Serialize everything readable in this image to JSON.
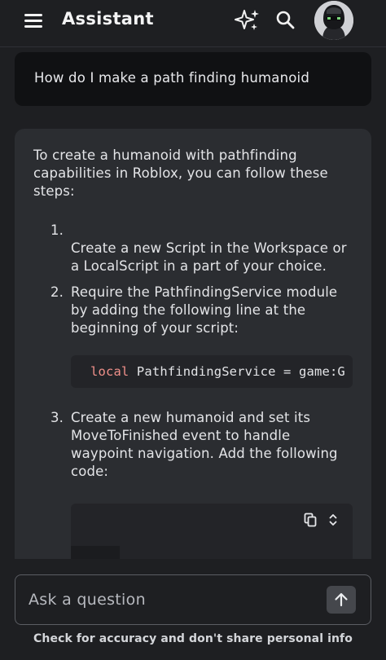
{
  "header": {
    "title": "Assistant",
    "menu_icon": "hamburger-menu-icon",
    "sparkle_icon": "sparkle-icon",
    "search_icon": "search-icon",
    "avatar_icon": "user-avatar"
  },
  "conversation": {
    "user_message": "How do I make a path finding humanoid",
    "assistant": {
      "intro": "To create a humanoid with pathfinding capabilities in Roblox, you can follow these steps:",
      "steps": [
        {
          "number": "1.",
          "text": "Create a new Script in the Workspace or a LocalScript in a part of your choice."
        },
        {
          "number": "2.",
          "text": "Require the PathfindingService module by adding the following line at the beginning of your script:"
        },
        {
          "number": "3.",
          "text": "Create a new humanoid and set its MoveToFinished event to handle waypoint navigation. Add the following code:"
        }
      ],
      "code_snippet": {
        "keyword": "local",
        "rest": " PathfindingService = game:G"
      },
      "code_block_icons": [
        "copy-icon",
        "expand-icon"
      ]
    }
  },
  "composer": {
    "placeholder": "Ask a question",
    "send_icon": "arrow-up-icon",
    "disclaimer": "Check for accuracy and don't share personal info"
  },
  "colors": {
    "background": "#1e1f22",
    "user_bubble": "#101113",
    "assistant_bubble": "#2b2d31",
    "code_background": "#232428",
    "code_keyword": "#f0908a"
  }
}
